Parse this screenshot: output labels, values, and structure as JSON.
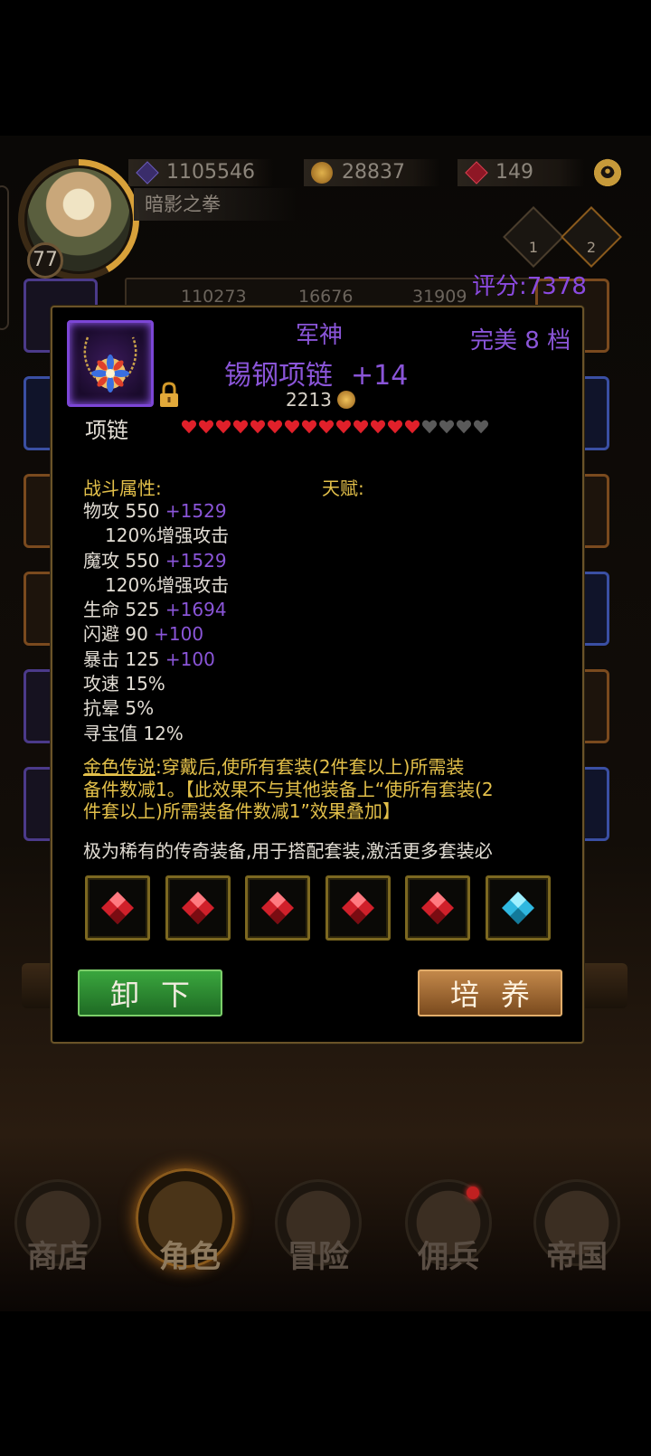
{
  "player": {
    "level": "77",
    "name": "暗影之拳"
  },
  "currencies": [
    {
      "icon": "gem-icon",
      "value": "1105546"
    },
    {
      "icon": "gold-coin-icon",
      "value": "28837"
    },
    {
      "icon": "ruby-icon",
      "value": "149"
    }
  ],
  "ranks": [
    "1",
    "2"
  ],
  "score": "评分:7378",
  "stat_strip": [
    "110273",
    "16676",
    "31909"
  ],
  "item": {
    "set_name": "军神",
    "name": "锡钢项链",
    "enhance": "+14",
    "grade": "完美 8 档",
    "price": "2213",
    "type": "项链",
    "stars_total": 18,
    "stars_filled": 14,
    "combat_label": "战斗属性:",
    "talent_label": "天赋:",
    "stats": [
      {
        "text": "物攻 550",
        "bonus": "+1529",
        "sub": false
      },
      {
        "text": "120%增强攻击",
        "bonus": "",
        "sub": true
      },
      {
        "text": "魔攻 550",
        "bonus": "+1529",
        "sub": false
      },
      {
        "text": "120%增强攻击",
        "bonus": "",
        "sub": true
      },
      {
        "text": "生命 525",
        "bonus": "+1694",
        "sub": false
      },
      {
        "text": "闪避 90",
        "bonus": "+100",
        "sub": false
      },
      {
        "text": "暴击 125",
        "bonus": "+100",
        "sub": false
      },
      {
        "text": "攻速 15%",
        "bonus": "",
        "sub": false
      },
      {
        "text": "抗晕 5%",
        "bonus": "",
        "sub": false
      },
      {
        "text": "寻宝值 12%",
        "bonus": "",
        "sub": false
      }
    ],
    "legend_name": "金色传说",
    "legend_line1": ":穿戴后,使所有套装(2件套以上)所需装",
    "legend_line2": "备件数减1。【此效果不与其他装备上“使所有套装(2",
    "legend_line3": "件套以上)所需装备件数减1”效果叠加】",
    "description": "极为稀有的传奇装备,用于搭配套装,激活更多套装必",
    "gems": [
      "red",
      "red",
      "red",
      "red",
      "red",
      "cyan"
    ]
  },
  "buttons": {
    "unequip": "卸下",
    "train": "培养"
  },
  "nav": [
    {
      "label": "商店",
      "active": false
    },
    {
      "label": "角色",
      "active": true
    },
    {
      "label": "冒险",
      "active": false
    },
    {
      "label": "佣兵",
      "active": false
    },
    {
      "label": "帝国",
      "active": false
    }
  ],
  "colors": {
    "purple": "#8a55d8",
    "gold": "#e3c04a",
    "heart_filled": "#e0202a",
    "heart_empty": "#5a5a5a"
  }
}
